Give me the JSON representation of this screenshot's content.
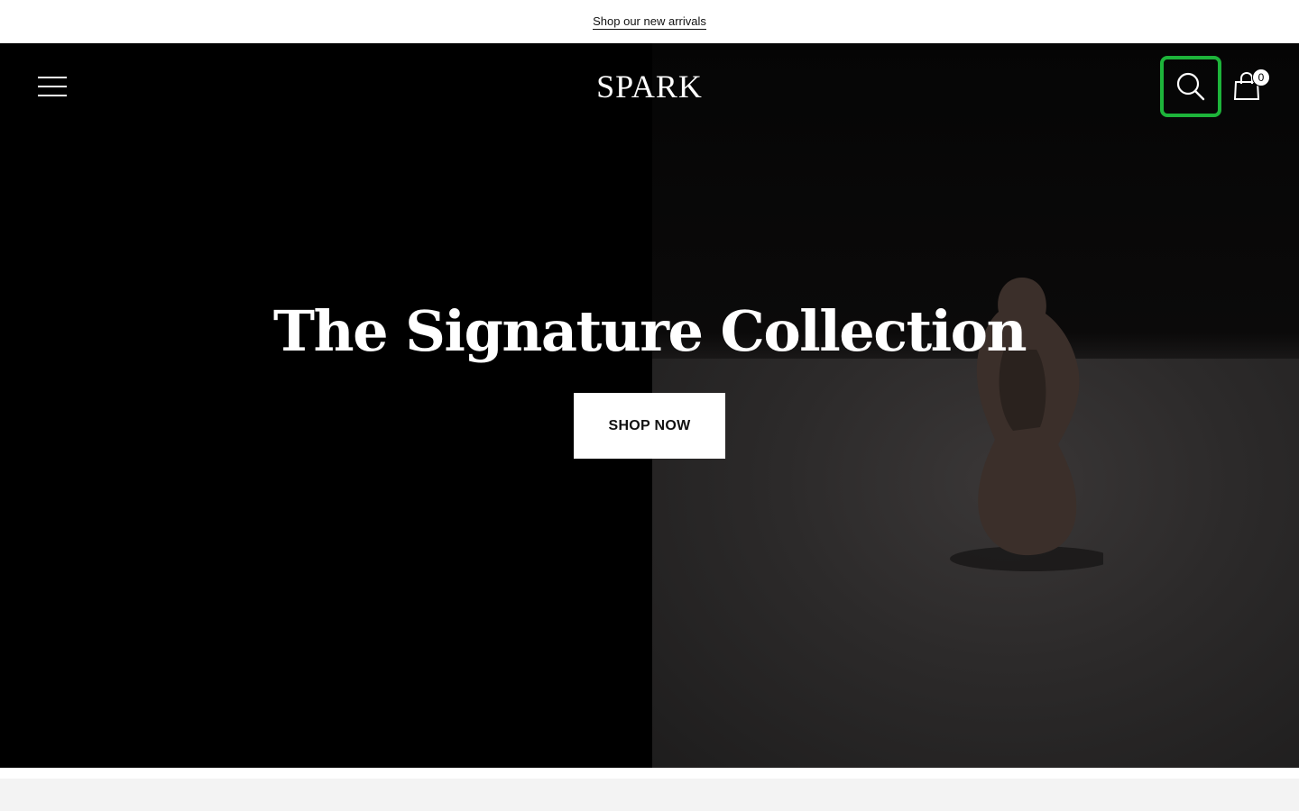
{
  "announcement": {
    "link_text": "Shop our new arrivals"
  },
  "header": {
    "logo": "SPARK",
    "menu_icon": "hamburger-menu-icon",
    "search_icon": "search-icon",
    "cart_icon": "shopping-bag-icon",
    "cart_count": "0",
    "focus_color": "#1db43a"
  },
  "hero": {
    "title": "The Signature Collection",
    "cta_label": "SHOP NOW"
  },
  "colors": {
    "background": "#000000",
    "accent_focus": "#1db43a",
    "text": "#ffffff"
  }
}
